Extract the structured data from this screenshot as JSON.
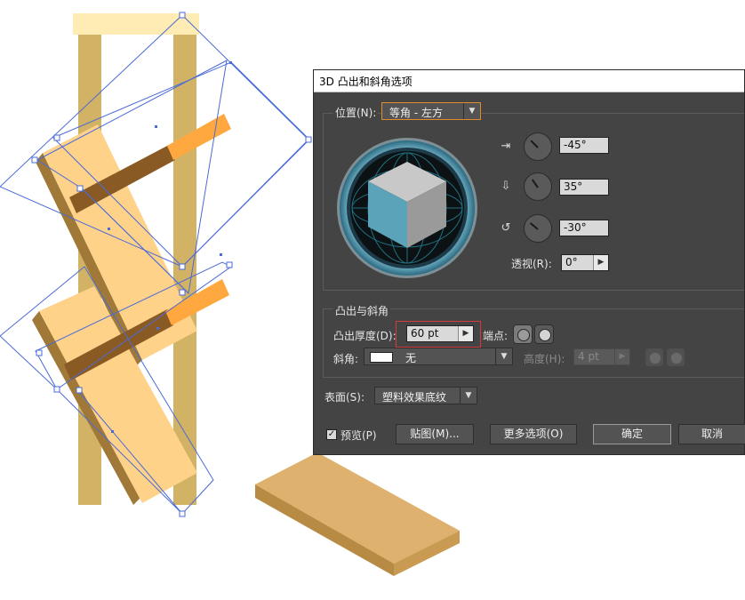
{
  "colors": {
    "wood_light": "#FFD28A",
    "wood_side": "#D8AA60",
    "pillar": "#D2B264",
    "pillar_top": "#FFEBB4",
    "peg_orange": "#FFA840",
    "peg_dark": "#8A5A24",
    "selection": "#4A6BD8",
    "dialog_bg": "#444444",
    "highlight": "#D63A3A"
  },
  "dialog": {
    "title": "3D 凸出和斜角选项",
    "position": {
      "label": "位置(N):",
      "preset": "等角 - 左方",
      "x_angle": "-45°",
      "y_angle": "35°",
      "z_angle": "-30°",
      "perspective_label": "透视(R):",
      "perspective_value": "0°",
      "icons": [
        "rotate-x-icon",
        "rotate-y-icon",
        "rotate-z-icon"
      ]
    },
    "extrude": {
      "section_label": "凸出与斜角",
      "depth_label": "凸出厚度(D):",
      "depth_value": "60 pt",
      "cap_label": "端点:",
      "bevel_label": "斜角:",
      "bevel_value": "无",
      "height_label": "高度(H):",
      "height_value": "4 pt"
    },
    "surface": {
      "label": "表面(S):",
      "value": "塑料效果底纹"
    },
    "buttons": {
      "preview_label": "预览(P)",
      "preview_checked": true,
      "map_art": "贴图(M)...",
      "more_options": "更多选项(O)",
      "ok": "确定",
      "cancel": "取消"
    }
  }
}
